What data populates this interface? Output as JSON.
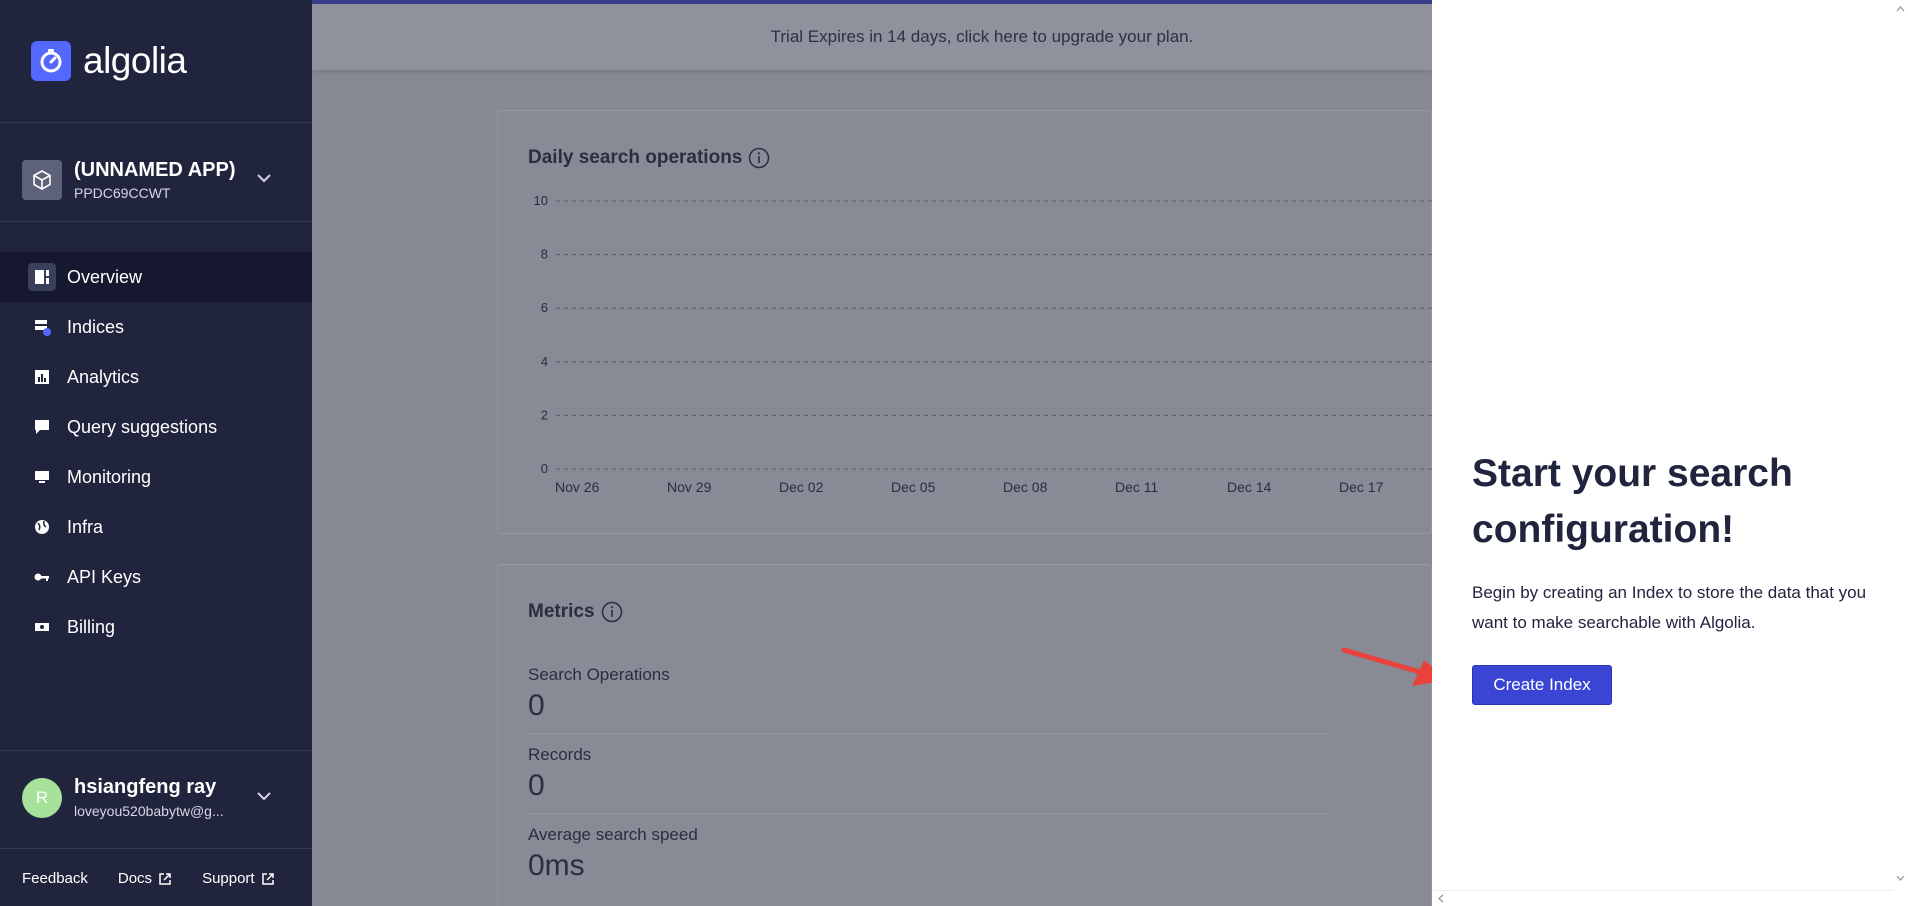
{
  "brand": {
    "name": "algolia",
    "accent": "#5468ff"
  },
  "app": {
    "name": "(UNNAMED APP)",
    "id": "PPDC69CCWT"
  },
  "nav": [
    {
      "label": "Overview",
      "icon": "overview-icon",
      "active": true
    },
    {
      "label": "Indices",
      "icon": "indices-icon"
    },
    {
      "label": "Analytics",
      "icon": "analytics-icon"
    },
    {
      "label": "Query suggestions",
      "icon": "query-suggestions-icon"
    },
    {
      "label": "Monitoring",
      "icon": "monitoring-icon"
    },
    {
      "label": "Infra",
      "icon": "globe-icon"
    },
    {
      "label": "API Keys",
      "icon": "key-icon"
    },
    {
      "label": "Billing",
      "icon": "billing-icon"
    }
  ],
  "user": {
    "initial": "R",
    "name": "hsiangfeng ray",
    "email": "loveyou520babytw@g..."
  },
  "footer": {
    "feedback": "Feedback",
    "docs": "Docs",
    "support": "Support"
  },
  "banner": {
    "text": "Trial Expires in 14 days, click here to upgrade your plan."
  },
  "daily_card": {
    "title": "Daily search operations"
  },
  "chart_data": {
    "type": "line",
    "title": "Daily search operations",
    "categories": [
      "Nov 26",
      "Nov 29",
      "Dec 02",
      "Dec 05",
      "Dec 08",
      "Dec 11",
      "Dec 14",
      "Dec 17"
    ],
    "y_ticks": [
      "10",
      "8",
      "6",
      "4",
      "2",
      "0"
    ],
    "ylim": [
      0,
      10
    ],
    "grid": true
  },
  "metrics_card": {
    "title": "Metrics",
    "items": [
      {
        "label": "Search Operations",
        "value": "0"
      },
      {
        "label": "Records",
        "value": "0"
      },
      {
        "label": "Average search speed",
        "value": "0ms"
      }
    ]
  },
  "panel": {
    "title": "Start your search configuration!",
    "description": "Begin by creating an Index to store the data that you want to make searchable with Algolia.",
    "button": "Create Index",
    "button_color": "#3a46d3"
  }
}
